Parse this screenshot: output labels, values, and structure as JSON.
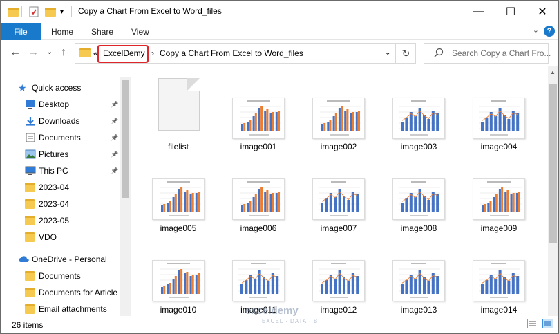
{
  "window": {
    "title": "Copy a Chart From Excel to Word_files",
    "minimize_glyph": "—",
    "maximize_glyph": "☐",
    "close_glyph": "✕"
  },
  "ribbon": {
    "file": "File",
    "tabs": [
      "Home",
      "Share",
      "View"
    ],
    "help": "?"
  },
  "nav": {
    "back_glyph": "←",
    "forward_glyph": "→",
    "recent_glyph": "⌄",
    "up_glyph": "↑",
    "prefix": "«",
    "crumbs": [
      "ExcelDemy",
      "Copy a Chart From Excel to Word_files"
    ],
    "separator": "›",
    "refresh_glyph": "↻",
    "search_placeholder": "Search Copy a Chart Fro..."
  },
  "sidebar": {
    "items": [
      {
        "label": "Quick access",
        "icon": "star-icon",
        "pinned": false
      },
      {
        "label": "Desktop",
        "icon": "desktop-icon",
        "pinned": true
      },
      {
        "label": "Downloads",
        "icon": "download-icon",
        "pinned": true
      },
      {
        "label": "Documents",
        "icon": "documents-icon",
        "pinned": true
      },
      {
        "label": "Pictures",
        "icon": "pictures-icon",
        "pinned": true
      },
      {
        "label": "This PC",
        "icon": "computer-icon",
        "pinned": true
      },
      {
        "label": "2023-04",
        "icon": "folder-icon",
        "pinned": false
      },
      {
        "label": "2023-04",
        "icon": "folder-icon",
        "pinned": false
      },
      {
        "label": "2023-05",
        "icon": "folder-icon",
        "pinned": false
      },
      {
        "label": "VDO",
        "icon": "folder-icon",
        "pinned": false
      },
      {
        "label": "OneDrive - Personal",
        "icon": "cloud-icon",
        "pinned": false
      },
      {
        "label": "Documents",
        "icon": "folder-icon",
        "pinned": false
      },
      {
        "label": "Documents for Article",
        "icon": "folder-icon",
        "pinned": false
      },
      {
        "label": "Email attachments",
        "icon": "folder-icon",
        "pinned": false
      }
    ]
  },
  "files": [
    {
      "name": "filelist",
      "type": "doc"
    },
    {
      "name": "image001",
      "type": "bar"
    },
    {
      "name": "image002",
      "type": "bar"
    },
    {
      "name": "image003",
      "type": "combo"
    },
    {
      "name": "image004",
      "type": "combo"
    },
    {
      "name": "image005",
      "type": "bar"
    },
    {
      "name": "image006",
      "type": "bar"
    },
    {
      "name": "image007",
      "type": "combo"
    },
    {
      "name": "image008",
      "type": "combo"
    },
    {
      "name": "image009",
      "type": "bar"
    },
    {
      "name": "image010",
      "type": "bar"
    },
    {
      "name": "image011",
      "type": "combo"
    },
    {
      "name": "image012",
      "type": "combo"
    },
    {
      "name": "image013",
      "type": "combo"
    },
    {
      "name": "image014",
      "type": "combo"
    }
  ],
  "status": {
    "count": "26 items"
  },
  "watermark": {
    "brand": "exceldemy",
    "tagline": "EXCEL · DATA · BI"
  },
  "colors": {
    "accent": "#1979ca",
    "highlight": "#e0262a",
    "bar_blue": "#4472c4",
    "bar_orange": "#ed7d31"
  }
}
